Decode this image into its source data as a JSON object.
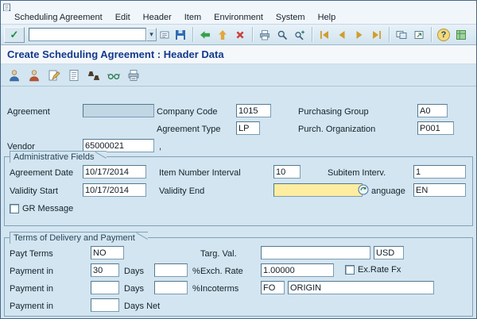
{
  "menu": {
    "items": [
      "Scheduling Agreement",
      "Edit",
      "Header",
      "Item",
      "Environment",
      "System",
      "Help"
    ]
  },
  "toolbar": {
    "command_value": ""
  },
  "icons": {
    "check": "✓",
    "dropdown": "▾",
    "help": "?"
  },
  "title": "Create Scheduling Agreement : Header Data",
  "form": {
    "agreement": {
      "label": "Agreement",
      "value": ""
    },
    "company_code": {
      "label": "Company Code",
      "value": "1015"
    },
    "purchasing_group": {
      "label": "Purchasing Group",
      "value": "A0"
    },
    "agreement_type": {
      "label": "Agreement Type",
      "value": "LP"
    },
    "purch_organization": {
      "label": "Purch. Organization",
      "value": "P001"
    },
    "vendor": {
      "label": "Vendor",
      "value": "65000021",
      "suffix": ","
    }
  },
  "admin": {
    "box_title": "Administrative Fields",
    "agreement_date": {
      "label": "Agreement Date",
      "value": "10/17/2014"
    },
    "item_number_interval": {
      "label": "Item Number Interval",
      "value": "10"
    },
    "subitem_interval": {
      "label": "Subitem Interv.",
      "value": "1"
    },
    "validity_start": {
      "label": "Validity Start",
      "value": "10/17/2014"
    },
    "validity_end": {
      "label": "Validity End",
      "value": ""
    },
    "language": {
      "label": "anguage",
      "value": "EN"
    },
    "gr_message": {
      "label": "GR Message",
      "checked": false
    }
  },
  "terms": {
    "box_title": "Terms of Delivery and Payment",
    "payt_terms": {
      "label": "Payt Terms",
      "value": "NO"
    },
    "targ_val": {
      "label": "Targ. Val.",
      "value": "",
      "currency": "USD"
    },
    "payment_in_label": "Payment in",
    "days_label": "Days",
    "percent_label": "%",
    "days_net_label": "Days Net",
    "payment1": {
      "value": "30",
      "pct": ""
    },
    "payment2": {
      "value": "",
      "pct": ""
    },
    "payment3": {
      "value": ""
    },
    "exch_rate": {
      "label": "Exch. Rate",
      "value": "1.00000"
    },
    "ex_rate_fx": {
      "label": "Ex.Rate Fx",
      "checked": false
    },
    "incoterms": {
      "label": "Incoterms",
      "value": "FO",
      "value2": "ORIGIN"
    }
  }
}
